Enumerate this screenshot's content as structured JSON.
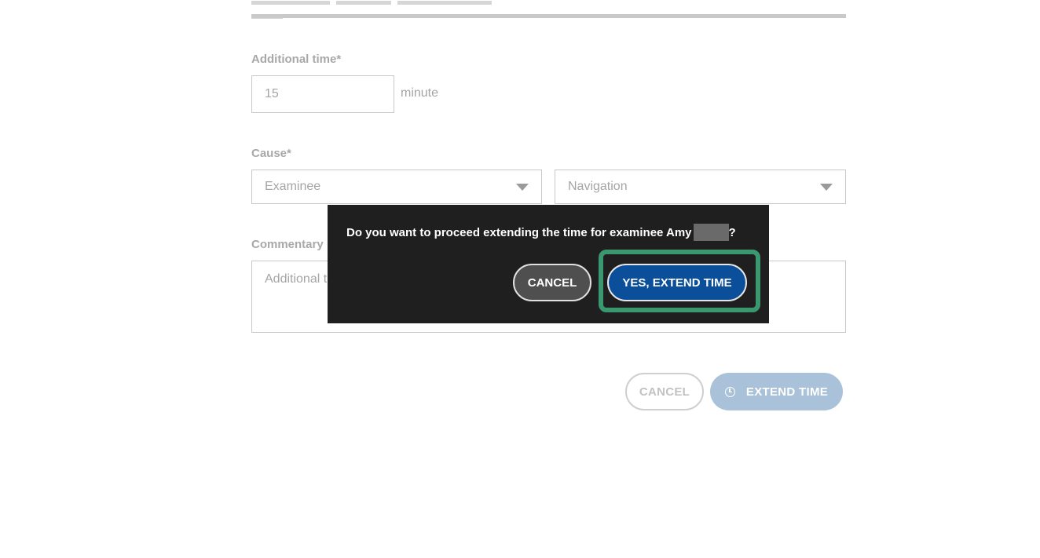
{
  "form": {
    "additional_time": {
      "label": "Additional time*",
      "value": "15",
      "unit": "minute"
    },
    "cause": {
      "label": "Cause*",
      "primary_value": "Examinee",
      "secondary_value": "Navigation"
    },
    "commentary": {
      "label": "Commentary",
      "placeholder_partial": "Additional t"
    },
    "buttons": {
      "cancel": "CANCEL",
      "extend": "EXTEND TIME"
    }
  },
  "dialog": {
    "message": "Do you want to proceed extending the time for examinee Amy",
    "message_end": "?",
    "cancel": "CANCEL",
    "confirm": "YES, EXTEND TIME"
  },
  "colors": {
    "dialog_bg": "#1f1f1f",
    "confirm_button": "#0b4f9a",
    "highlight": "#3a9870",
    "extend_button_disabled": "#a9c1d9"
  },
  "icons": {
    "extend_button": "clock-icon",
    "select": "chevron-down-icon"
  }
}
